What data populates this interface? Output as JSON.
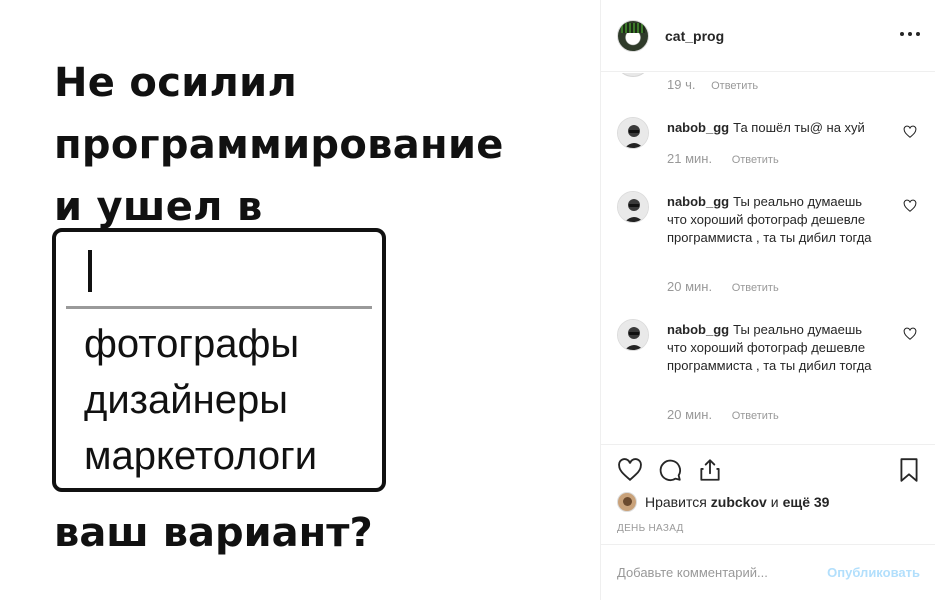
{
  "meme": {
    "headline": [
      "Не осилил",
      "программирование",
      "и ушел в"
    ],
    "options": [
      "фотографы",
      "дизайнеры",
      "маркетологи"
    ],
    "question": "ваш вариант?"
  },
  "header": {
    "username": "cat_prog"
  },
  "previous_comment": {
    "time": "19 ч.",
    "reply": "Ответить"
  },
  "comments": [
    {
      "user": "nabob_gg",
      "text": "Та пошёл ты@ на хуй",
      "time": "21 мин.",
      "reply": "Ответить"
    },
    {
      "user": "nabob_gg",
      "text": "Ты реально думаешь что хороший фотограф дешевле программиста , та ты дибил тогда",
      "time": "20 мин.",
      "reply": "Ответить"
    },
    {
      "user": "nabob_gg",
      "text": "Ты реально думаешь что хороший фотограф дешевле программиста , та ты дибил тогда",
      "time": "20 мин.",
      "reply": "Ответить"
    }
  ],
  "likes": {
    "prefix": "Нравится",
    "user": "zubckov",
    "joiner": "и",
    "others": "ещё 39"
  },
  "date": "день назад",
  "add_comment": {
    "placeholder": "Добавьте комментарий...",
    "publish": "Опубликовать"
  },
  "icons": [
    "more-icon",
    "heart-icon",
    "comment-icon",
    "share-icon",
    "bookmark-icon"
  ]
}
